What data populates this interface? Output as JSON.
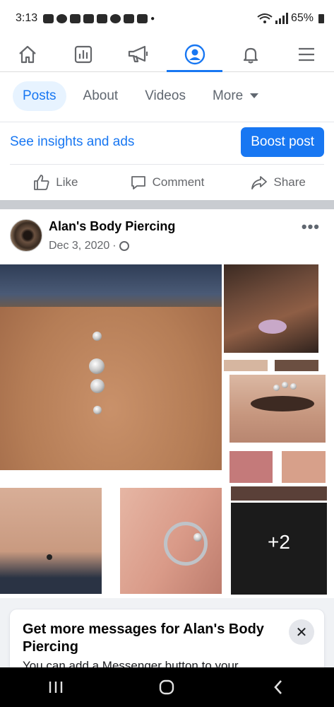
{
  "status_bar": {
    "time": "3:13",
    "battery": "65%"
  },
  "nav": {
    "items": [
      {
        "name": "home-icon"
      },
      {
        "name": "pages-insights-icon"
      },
      {
        "name": "megaphone-icon"
      },
      {
        "name": "profile-icon",
        "active": true
      },
      {
        "name": "bell-icon"
      },
      {
        "name": "menu-icon"
      }
    ],
    "accent": "#1877f2"
  },
  "tabs": {
    "posts": "Posts",
    "about": "About",
    "videos": "Videos",
    "more": "More"
  },
  "insights": {
    "link": "See insights and ads",
    "boost": "Boost post"
  },
  "actions": {
    "like": "Like",
    "comment": "Comment",
    "share": "Share"
  },
  "post": {
    "author": "Alan's Body Piercing",
    "date": "Dec 3, 2020",
    "separator": "·",
    "more_count": "+2"
  },
  "promo": {
    "title": "Get more messages for Alan's Body Piercing",
    "body": "You can add a Messenger button to your"
  }
}
